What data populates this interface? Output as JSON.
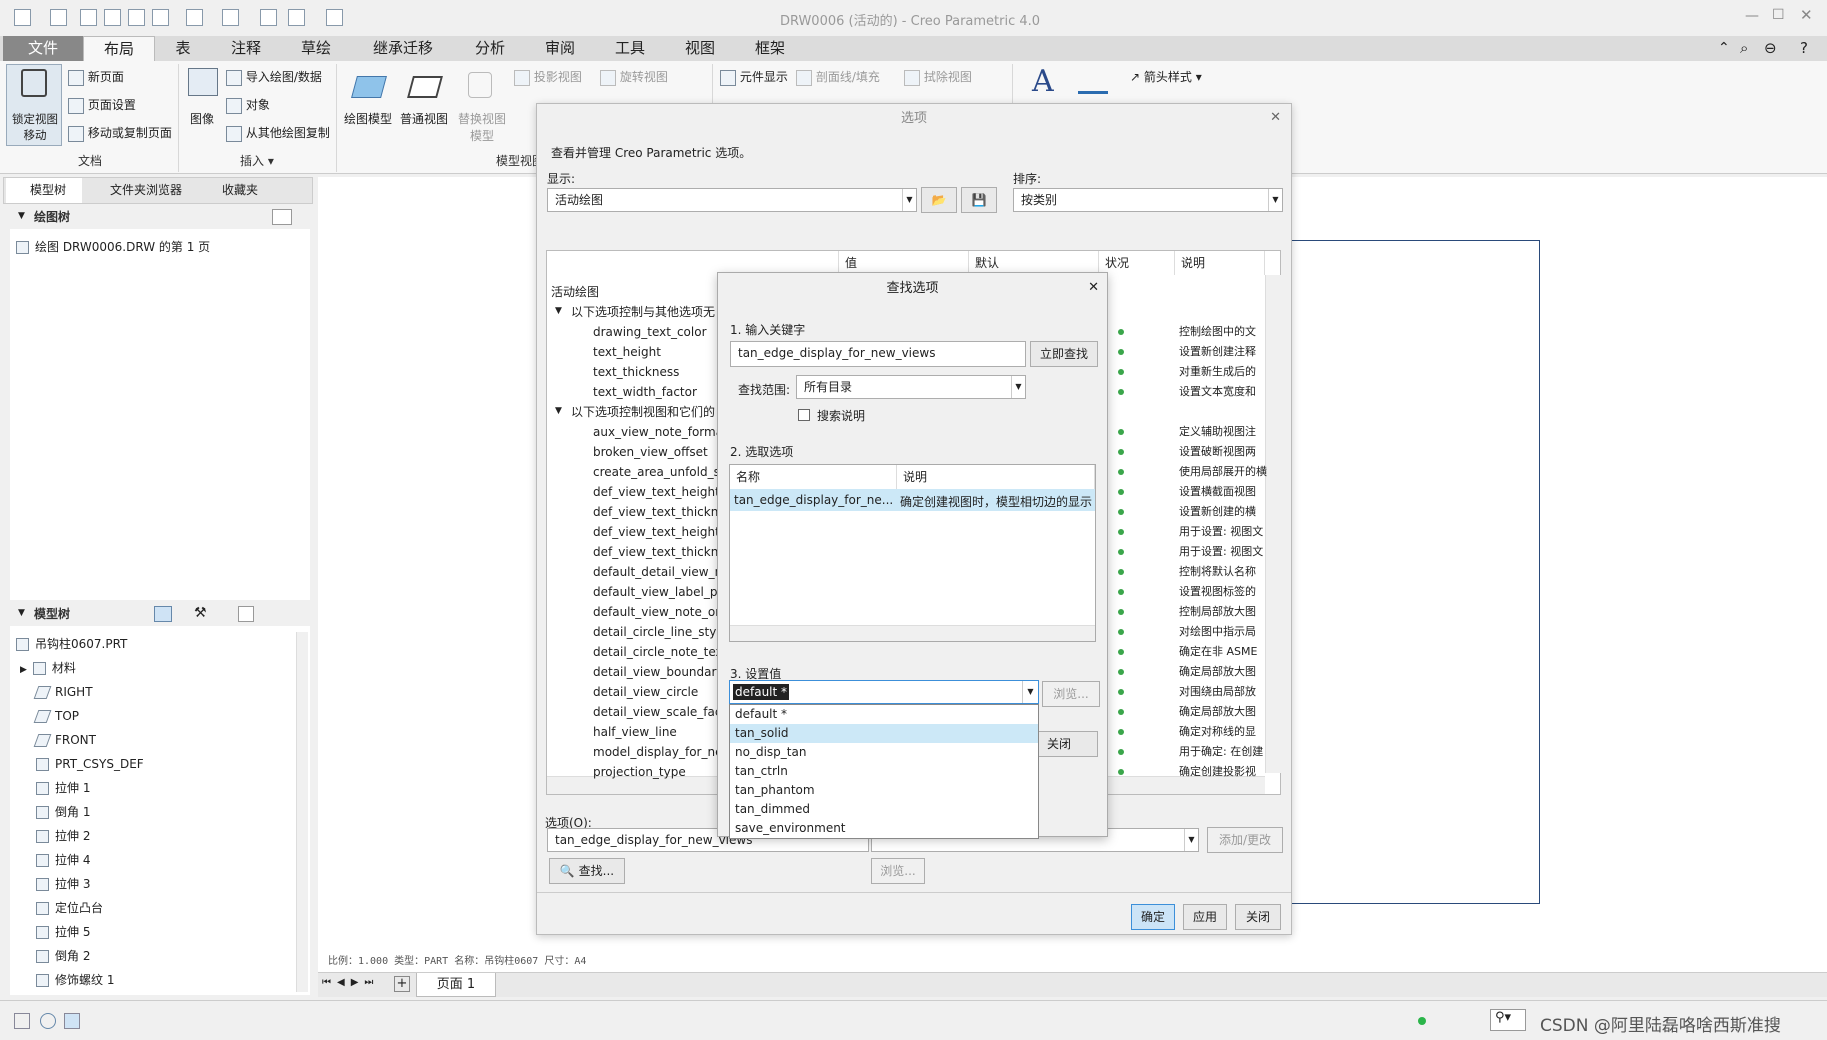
{
  "window": {
    "title": "DRW0006 (活动的) - Creo Parametric 4.0"
  },
  "tabs": [
    "文件",
    "布局",
    "表",
    "注释",
    "草绘",
    "继承迁移",
    "分析",
    "审阅",
    "工具",
    "视图",
    "框架"
  ],
  "ribbon": {
    "lock_view": "锁定视图\n移动",
    "new_page": "新页面",
    "page_setup": "页面设置",
    "move_copy_page": "移动或复制页面",
    "image": "图像",
    "import_drawing": "导入绘图/数据",
    "object": "对象",
    "copy_from_other": "从其他绘图复制",
    "drawing_model": "绘图模型",
    "general_view": "普通视图",
    "replace_model": "替换视图\n模型",
    "projection_view": "投影视图",
    "rotate_view": "旋转视图",
    "element_display": "元件显示",
    "section_fill": "剖面线/填充",
    "erase_view": "拭除视图",
    "arrow_style": "箭头样式",
    "group_doc": "文档",
    "group_insert": "插入 ▾",
    "group_model_view": "模型视图"
  },
  "left_tabs": [
    "模型树",
    "文件夹浏览器",
    "收藏夹"
  ],
  "drawing_tree": {
    "header": "绘图树",
    "item": "绘图 DRW0006.DRW 的第 1 页"
  },
  "model_tree": {
    "header": "模型树",
    "items": [
      "吊钩柱0607.PRT",
      "材料",
      "RIGHT",
      "TOP",
      "FRONT",
      "PRT_CSYS_DEF",
      "拉伸 1",
      "倒角 1",
      "拉伸 2",
      "拉伸 4",
      "拉伸 3",
      "定位凸台",
      "拉伸 5",
      "倒角 2",
      "修饰螺纹 1"
    ]
  },
  "status_line": "比例：1.000  类型：PART  名称：吊钩柱0607  尺寸：A4",
  "page_tab": "页面 1",
  "watermark": "CSDN @阿里陆磊咯啥西斯准搜",
  "options": {
    "title": "选项",
    "subtitle": "查看并管理 Creo Parametric 选项。",
    "display_label": "显示:",
    "display_value": "活动绘图",
    "sort_label": "排序:",
    "sort_value": "按类别",
    "columns": [
      "值",
      "默认",
      "状况",
      "说明"
    ],
    "rows": [
      {
        "name": "活动绘图",
        "desc": ""
      },
      {
        "name": "以下选项控制与其他选项无",
        "desc": ""
      },
      {
        "name": "drawing_text_color",
        "desc": "控制绘图中的文"
      },
      {
        "name": "text_height",
        "desc": "设置新创建注释"
      },
      {
        "name": "text_thickness",
        "desc": "对重新生成后的"
      },
      {
        "name": "text_width_factor",
        "desc": "设置文本宽度和"
      },
      {
        "name": "以下选项控制视图和它们的",
        "desc": ""
      },
      {
        "name": "aux_view_note_format",
        "desc": "定义辅助视图注"
      },
      {
        "name": "broken_view_offset",
        "desc": "设置破断视图两"
      },
      {
        "name": "create_area_unfold_se",
        "desc": "使用局部展开的横"
      },
      {
        "name": "def_view_text_height",
        "desc": "设置横截面视图"
      },
      {
        "name": "def_view_text_thickne",
        "desc": "设置新创建的横"
      },
      {
        "name": "def_view_text_height_s",
        "desc": "用于设置: 视图文"
      },
      {
        "name": "def_view_text_thickne",
        "desc": "用于设置: 视图文"
      },
      {
        "name": "default_detail_view_na",
        "desc": "控制将默认名称"
      },
      {
        "name": "default_view_label_pla",
        "desc": "设置视图标签的"
      },
      {
        "name": "default_view_note_orie",
        "desc": "控制局部放大图"
      },
      {
        "name": "detail_circle_line_style",
        "desc": "对绘图中指示局"
      },
      {
        "name": "detail_circle_note_text",
        "desc": "确定在非 ASME"
      },
      {
        "name": "detail_view_boundary_",
        "desc": "确定局部放大图"
      },
      {
        "name": "detail_view_circle",
        "desc": "对围绕由局部放"
      },
      {
        "name": "detail_view_scale_facto",
        "desc": "确定局部放大图"
      },
      {
        "name": "half_view_line",
        "desc": "确定对称线的显"
      },
      {
        "name": "model_display_for_ne",
        "desc": "用于确定: 在创建"
      },
      {
        "name": "projection_type",
        "desc": "确定创建投影视"
      }
    ],
    "option_label": "选项(O):",
    "option_value": "tan_edge_display_for_new_views",
    "find_button": "查找...",
    "browse_button": "浏览...",
    "add_change_button": "添加/更改",
    "ok_button": "确定",
    "apply_button": "应用",
    "close_button": "关闭"
  },
  "find": {
    "title": "查找选项",
    "step1": "1.  输入关键字",
    "keyword": "tan_edge_display_for_new_views",
    "search_now": "立即查找",
    "scope_label": "查找范围:",
    "scope_value": "所有目录",
    "search_desc": "搜索说明",
    "step2": "2.  选取选项",
    "list_cols": [
      "名称",
      "说明"
    ],
    "list_row": {
      "name": "tan_edge_display_for_ne...",
      "desc": "确定创建视图时，模型相切边的显示"
    },
    "step3": "3.  设置值",
    "value": "default *",
    "browse": "浏览...",
    "close": "关闭",
    "options": [
      "default *",
      "tan_solid",
      "no_disp_tan",
      "tan_ctrln",
      "tan_phantom",
      "tan_dimmed",
      "save_environment"
    ]
  }
}
